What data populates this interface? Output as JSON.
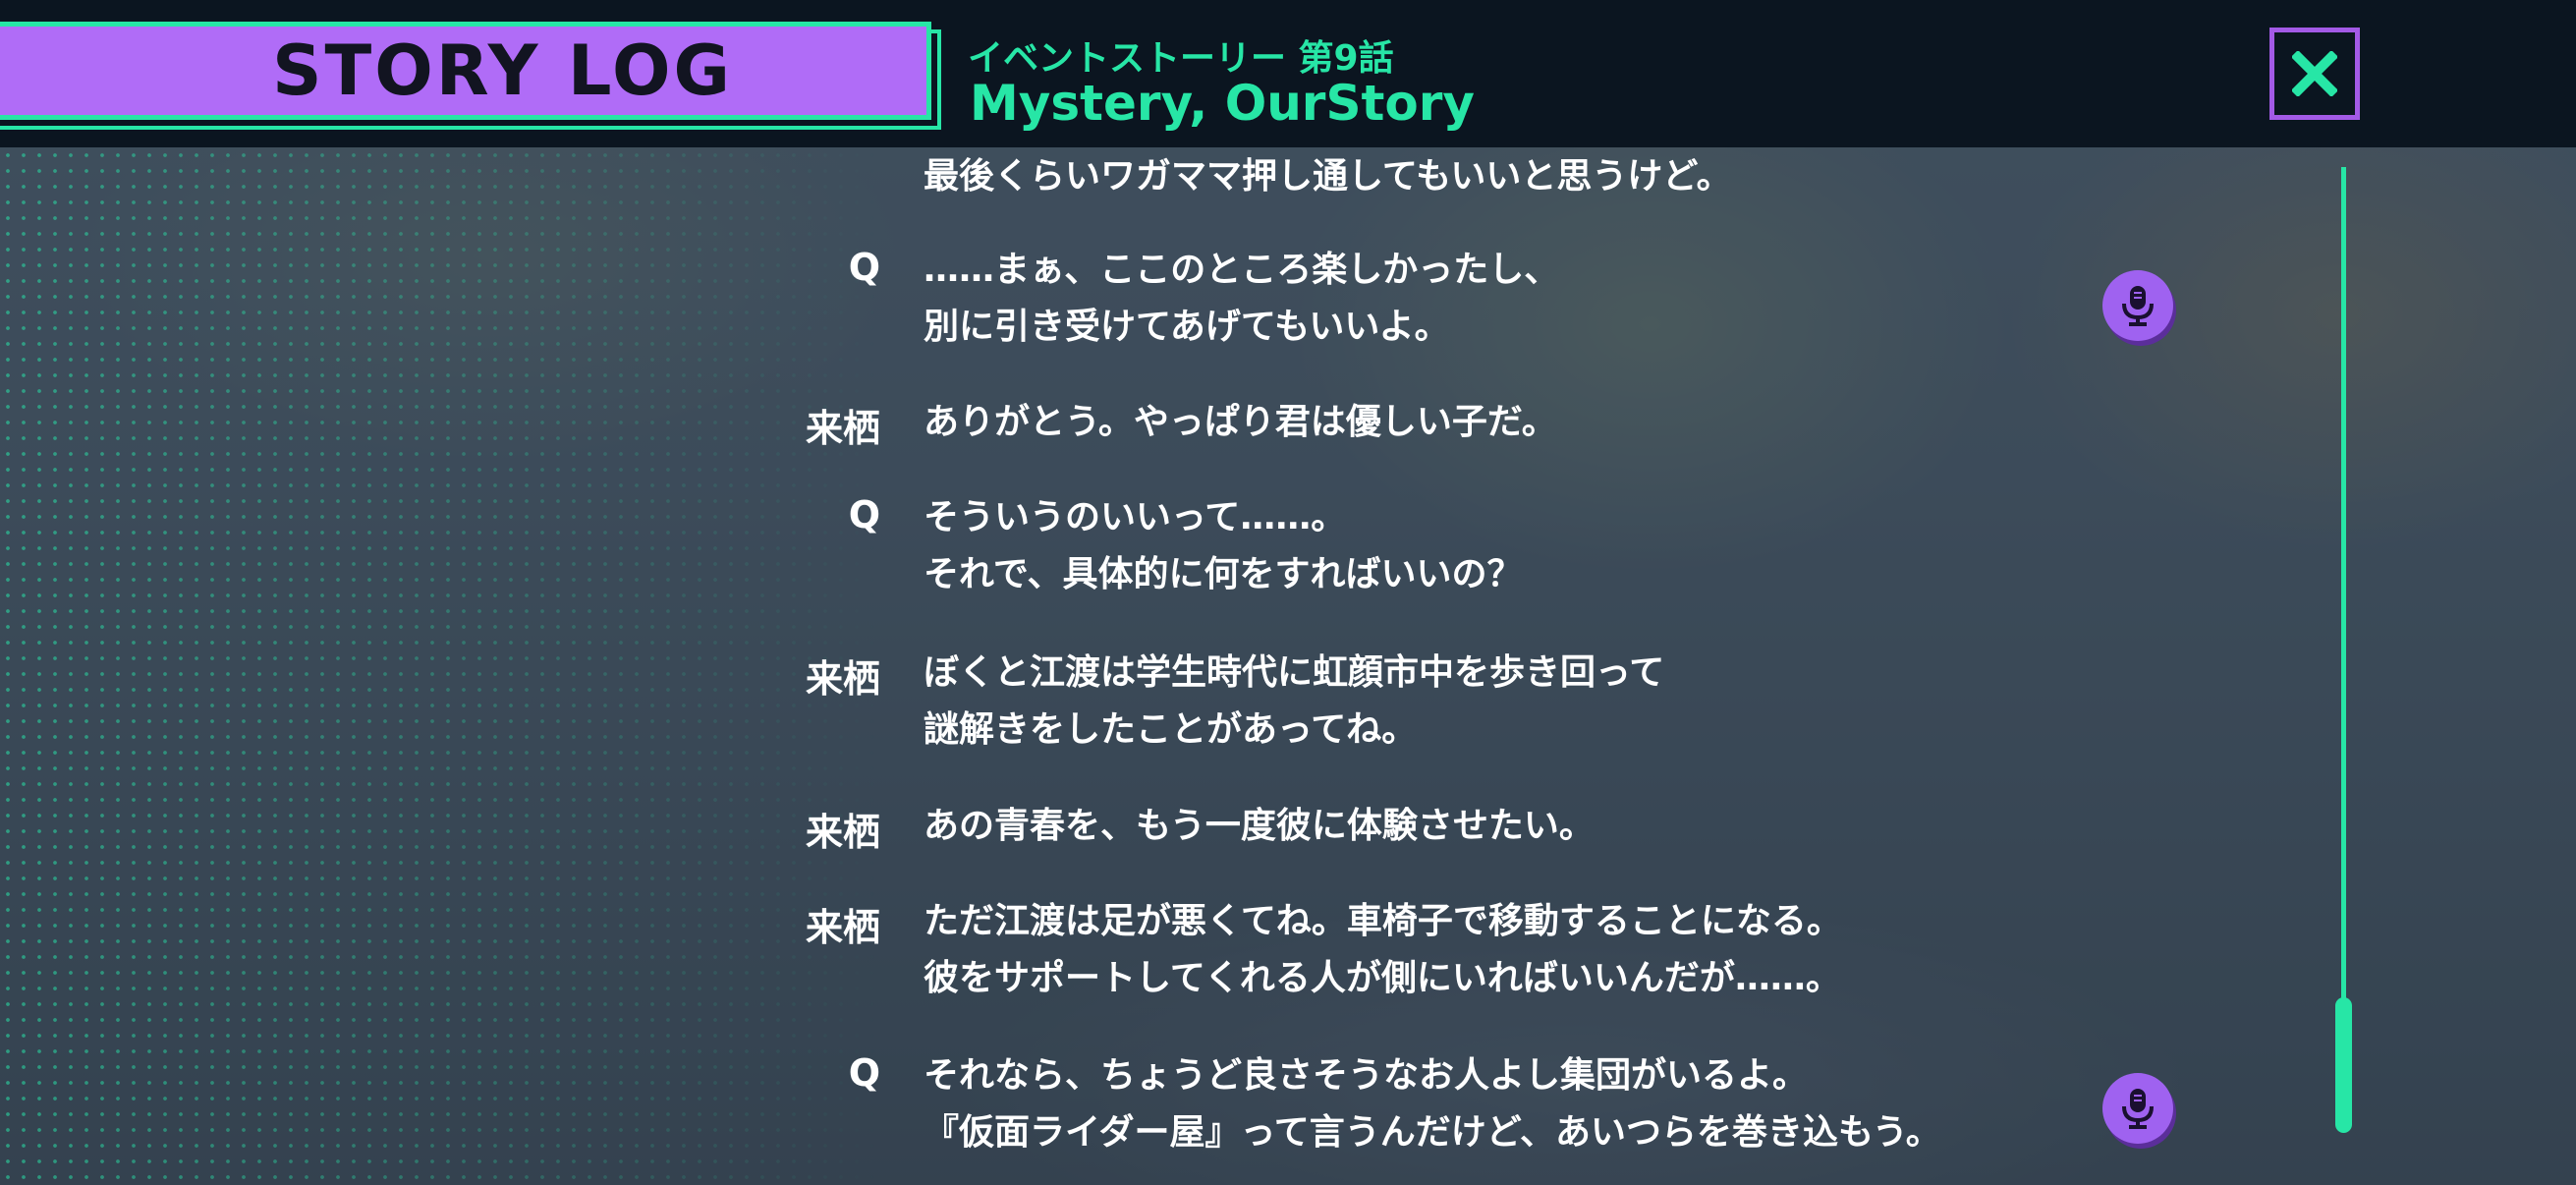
{
  "header": {
    "title": "STORY LOG",
    "episode_label": "イベントストーリー 第9話",
    "episode_title": "Mystery, OurStory"
  },
  "close_button": {
    "icon": "close-icon",
    "color": "#27e6a6"
  },
  "entries": [
    {
      "speaker": "",
      "lines": [
        "最後くらいワガママ押し通してもいいと思うけど。"
      ],
      "voice": false
    },
    {
      "speaker": "Q",
      "lines": [
        "……まぁ、ここのところ楽しかったし、",
        "別に引き受けてあげてもいいよ。"
      ],
      "voice": true
    },
    {
      "speaker": "来栖",
      "lines": [
        "ありがとう。やっぱり君は優しい子だ。"
      ],
      "voice": false
    },
    {
      "speaker": "Q",
      "lines": [
        "そういうのいいって……。",
        "それで、具体的に何をすればいいの？"
      ],
      "voice": false
    },
    {
      "speaker": "来栖",
      "lines": [
        "ぼくと江渡は学生時代に虹顔市中を歩き回って",
        "謎解きをしたことがあってね。"
      ],
      "voice": false
    },
    {
      "speaker": "来栖",
      "lines": [
        "あの青春を、もう一度彼に体験させたい。"
      ],
      "voice": false
    },
    {
      "speaker": "来栖",
      "lines": [
        "ただ江渡は足が悪くてね。車椅子で移動することになる。",
        "彼をサポートしてくれる人が側にいればいいんだが……。"
      ],
      "voice": false
    },
    {
      "speaker": "Q",
      "lines": [
        "それなら、ちょうど良さそうなお人よし集団がいるよ。",
        "『仮面ライダー屋』って言うんだけど、あいつらを巻き込もう。"
      ],
      "voice": true
    }
  ],
  "voice_icon": "microphone-icon",
  "colors": {
    "accent_green": "#27e6a6",
    "accent_purple": "#b06cf7",
    "header_bg": "#0b1520"
  }
}
